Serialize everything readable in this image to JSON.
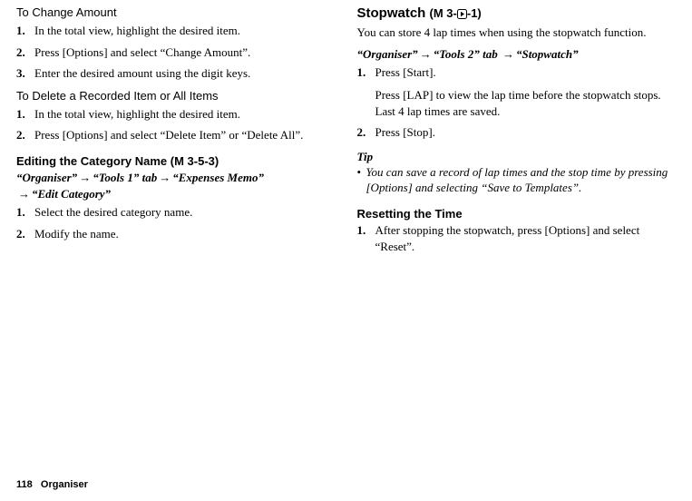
{
  "left": {
    "change_amount": {
      "heading": "To Change Amount",
      "steps": [
        "In the total view, highlight the desired item.",
        "Press [Options] and select “Change Amount”.",
        "Enter the desired amount using the digit keys."
      ]
    },
    "delete_item": {
      "heading": "To Delete a Recorded Item or All Items",
      "steps": [
        "In the total view, highlight the desired item.",
        "Press [Options] and select “Delete Item” or “Delete All”."
      ]
    },
    "edit_category": {
      "heading": "Editing the Category Name",
      "mcode": "(M 3-5-3)",
      "breadcrumb": [
        "“Organiser”",
        "“Tools 1” tab",
        "“Expenses Memo”",
        "“Edit Category”"
      ],
      "steps": [
        "Select the desired category name.",
        "Modify the name."
      ]
    }
  },
  "right": {
    "stopwatch": {
      "heading": "Stopwatch",
      "mcode_prefix": "(M 3-",
      "mcode_suffix": "-1)",
      "intro": "You can store 4 lap times when using the stopwatch function.",
      "breadcrumb": [
        "“Organiser”",
        "“Tools 2” tab",
        "“Stopwatch”"
      ],
      "steps": [
        "Press [Start].",
        "Press [Stop]."
      ],
      "sub_after_1": "Press [LAP] to view the lap time before the stopwatch stops. Last 4 lap times are saved.",
      "tip_label": "Tip",
      "tip_body": "You can save a record of lap times and the stop time by pressing [Options] and selecting “Save to Templates”."
    },
    "reset": {
      "heading": "Resetting the Time",
      "steps": [
        "After stopping the stopwatch, press [Options] and select “Reset”."
      ]
    }
  },
  "footer": {
    "page_num": "118",
    "section": "Organiser"
  },
  "glyphs": {
    "arrow": "→"
  }
}
